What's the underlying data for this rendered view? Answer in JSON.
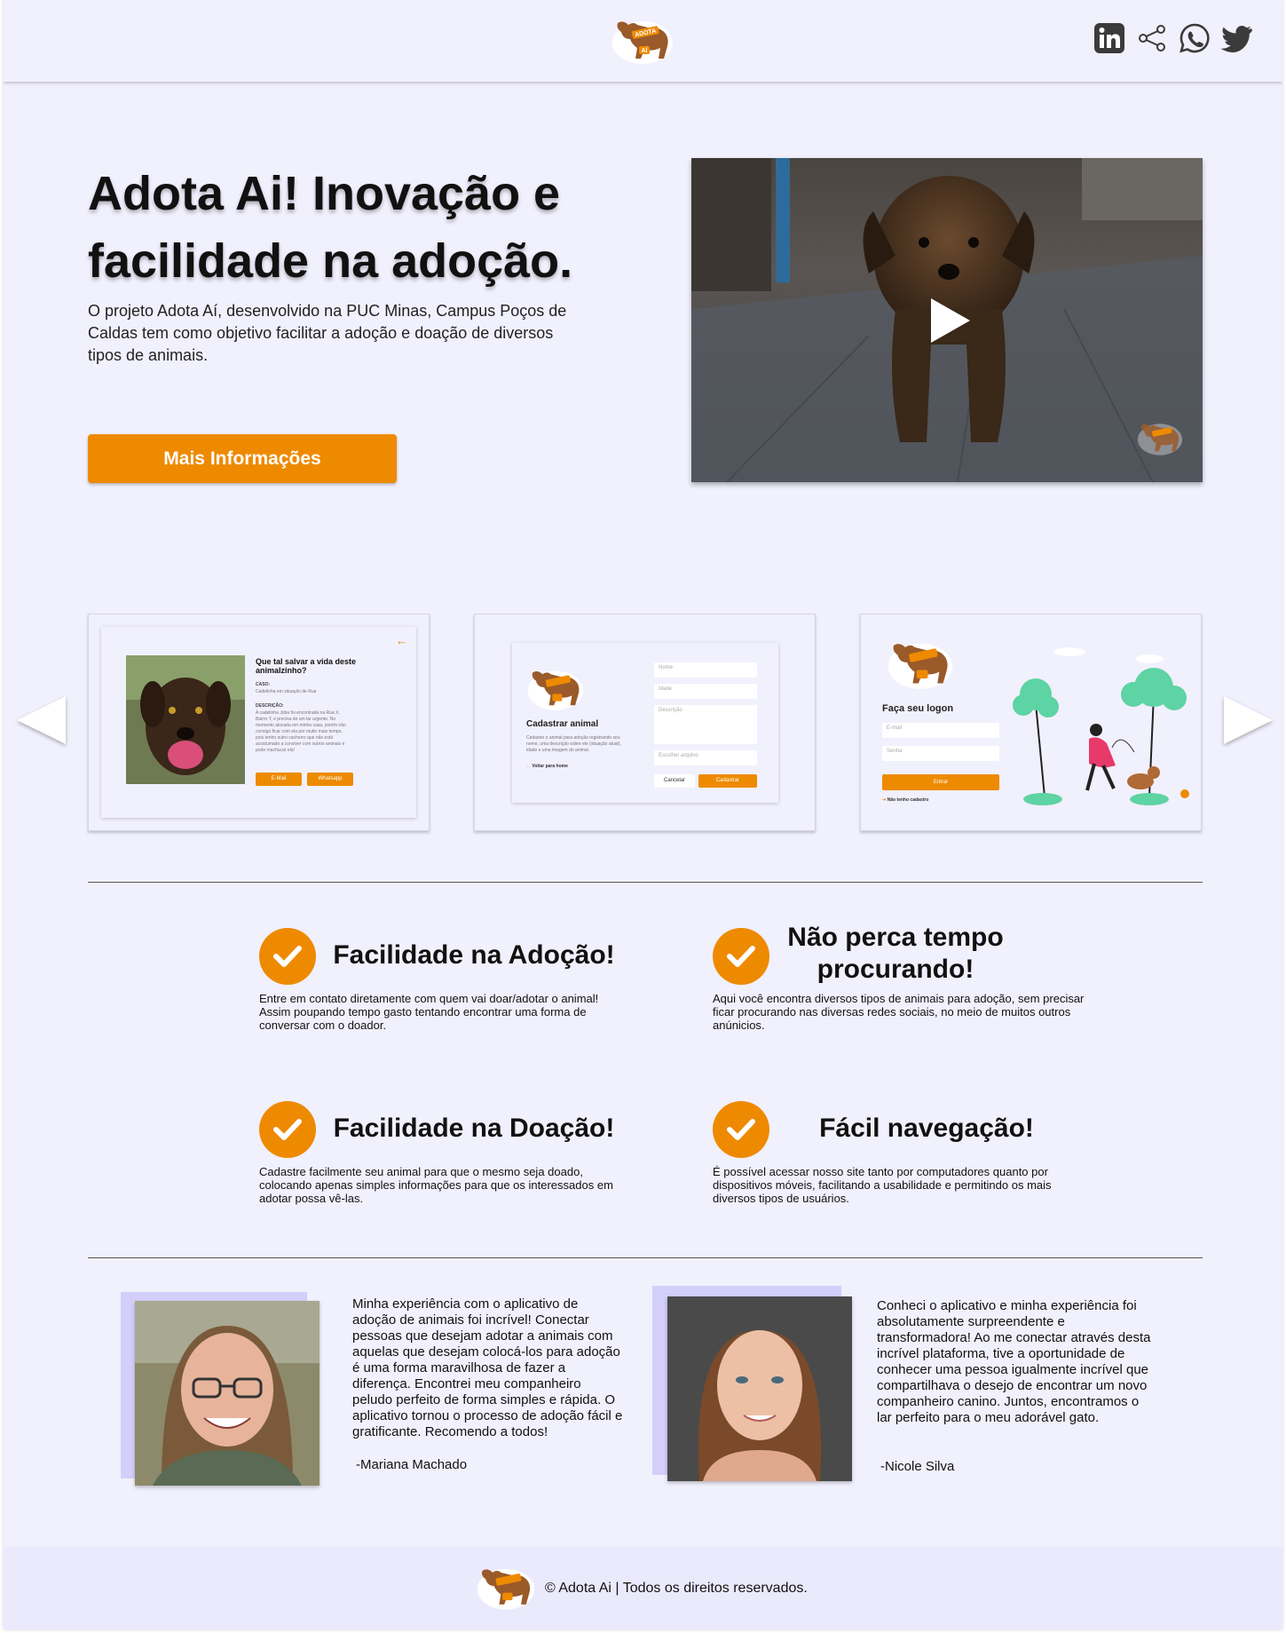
{
  "brand": {
    "logo_text_top": "ADOTA",
    "logo_text_bottom": "AÍ",
    "accent": "#ee8a00",
    "background": "#f1f0fd"
  },
  "header": {
    "social_icons": [
      "linkedin-icon",
      "share-icon",
      "whatsapp-icon",
      "twitter-icon"
    ]
  },
  "hero": {
    "title": "Adota Ai! Inovação e facilidade na adoção.",
    "description": "O projeto Adota Aí, desenvolvido na PUC Minas, Campus Poços de Caldas tem como objetivo facilitar a adoção e doação de diversos tipos de animais.",
    "button_label": "Mais Informações"
  },
  "carousel": {
    "slide1": {
      "title": "Que tal salvar a vida deste animalzinho?",
      "case_label": "CASO:",
      "case_text": "Cadelinha em situação de Rua",
      "desc_label": "DESCRIÇÃO:",
      "desc_text": "A cadelinha Joba foi encontrada na Rua X, Bairro Y, e precisa de um lar urgente. No momento alocada em minha casa, porém não consigo ficar com ela por muito mais tempo, pois tenho outro cachorro que não está acostumado a conviver com outros animais e pode machucar ela!",
      "btn_email": "E-Mail",
      "btn_whatsapp": "Whatsapp"
    },
    "slide2": {
      "title": "Cadastrar animal",
      "desc": "Cadastre o animal para adoção registrando seu nome, uma descrição sobre ele (situação atual), idade e uma imagem do animal.",
      "back_link": "Voltar para home",
      "field_name": "Nome",
      "field_age": "Idade",
      "field_desc": "Descrição",
      "field_file": "Escolher arquivo",
      "btn_cancel": "Cancelar",
      "btn_submit": "Cadastrar"
    },
    "slide3": {
      "title": "Faça seu logon",
      "field_email": "E-mail",
      "field_password": "Senha",
      "btn_login": "Entrar",
      "register_link": "Não tenho cadastro"
    }
  },
  "features": [
    {
      "title": "Facilidade na Adoção!",
      "description": "Entre em contato diretamente com quem vai doar/adotar o animal! Assim poupando tempo gasto tentando encontrar uma forma de conversar com o doador."
    },
    {
      "title": "Não perca tempo procurando!",
      "description": "Aqui você encontra diversos tipos de animais para adoção, sem precisar ficar procurando nas diversas redes sociais, no meio de muitos outros anúnicios."
    },
    {
      "title": "Facilidade na Doação!",
      "description": "Cadastre facilmente seu animal para que o mesmo seja doado, colocando apenas simples informações para que os interessados em adotar possa vê-las."
    },
    {
      "title": "Fácil navegação!",
      "description": "É possível acessar nosso site tanto por computadores quanto por dispositivos móveis, facilitando a usabilidade e permitindo os mais diversos tipos de usuários."
    }
  ],
  "testimonials": [
    {
      "quote": "Minha experiência com o aplicativo de adoção de animais foi incrível! Conectar pessoas que desejam adotar a animais com aquelas que desejam colocá-los para adoção é uma forma maravilhosa de fazer a diferença. Encontrei meu companheiro peludo perfeito de forma simples e rápida. O aplicativo tornou o processo de adoção fácil e gratificante. Recomendo a todos!",
      "author": "-Mariana Machado"
    },
    {
      "quote": "Conheci o aplicativo e minha experiência foi absolutamente surpreendente e transformadora! Ao me conectar através desta incrível plataforma, tive a oportunidade de conhecer uma pessoa igualmente incrível que compartilhava o desejo de encontrar um novo companheiro canino. Juntos, encontramos o lar perfeito para o meu adorável gato.",
      "author": "-Nicole Silva"
    }
  ],
  "footer": {
    "copyright": "© Adota Ai | Todos os direitos reservados."
  }
}
